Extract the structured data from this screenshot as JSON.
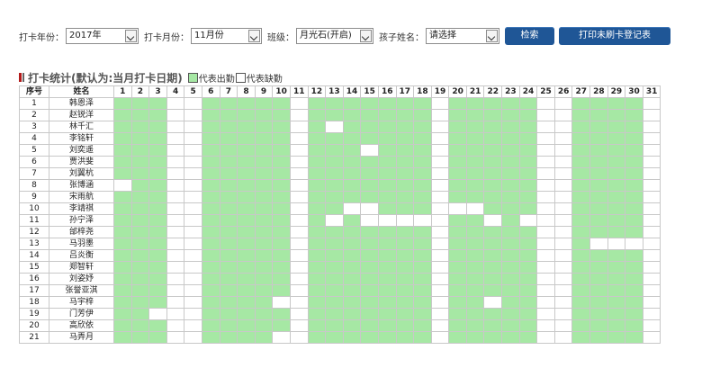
{
  "filters": {
    "year_label": "打卡年份：",
    "year_value": "2017年",
    "month_label": "打卡月份：",
    "month_value": "11月份",
    "class_label": "班级：",
    "class_value": "月光石(开启)",
    "child_label": "孩子姓名：",
    "child_value": "请选择",
    "search_button": "检索",
    "print_button": "打印未刷卡登记表"
  },
  "section": {
    "title": "打卡统计(默认为:当月打卡日期)",
    "legend_present": "代表出勤",
    "legend_absent": "代表缺勤",
    "present_color": "#a6e8a4",
    "absent_color": "#ffffff"
  },
  "table": {
    "col_no": "序号",
    "col_name": "姓名",
    "days": [
      "1",
      "2",
      "3",
      "4",
      "5",
      "6",
      "7",
      "8",
      "9",
      "10",
      "11",
      "12",
      "13",
      "14",
      "15",
      "16",
      "17",
      "18",
      "19",
      "20",
      "21",
      "22",
      "23",
      "24",
      "25",
      "26",
      "27",
      "28",
      "29",
      "30",
      "31"
    ],
    "rows": [
      {
        "no": "1",
        "name": "韩恩泽",
        "attendance": "1110011111011111110111110011110"
      },
      {
        "no": "2",
        "name": "赵锐洋",
        "attendance": "1110011111011111110111110011110"
      },
      {
        "no": "3",
        "name": "林千汇",
        "attendance": "1110011111010111110111110011110"
      },
      {
        "no": "4",
        "name": "李铭轩",
        "attendance": "1110011111011111110111110011110"
      },
      {
        "no": "5",
        "name": "刘奕遥",
        "attendance": "1110011111011101110111110011110"
      },
      {
        "no": "6",
        "name": "贾洪斐",
        "attendance": "1110011111011111110111110011110"
      },
      {
        "no": "7",
        "name": "刘翼杭",
        "attendance": "1110011111011111110111110011110"
      },
      {
        "no": "8",
        "name": "张博涵",
        "attendance": "0110011111011111110111110011110"
      },
      {
        "no": "9",
        "name": "宋雨航",
        "attendance": "1110011111011111110111110011110"
      },
      {
        "no": "10",
        "name": "李靖祺",
        "attendance": "1110011111011001110001110011110"
      },
      {
        "no": "11",
        "name": "孙宁泽",
        "attendance": "1110011111010100000110100011110"
      },
      {
        "no": "12",
        "name": "邰梓尧",
        "attendance": "1110011111011111110111110011110"
      },
      {
        "no": "13",
        "name": "马羽墨",
        "attendance": "1110011111011111110111110010000"
      },
      {
        "no": "14",
        "name": "吕炎衡",
        "attendance": "1110011111011111110111110011110"
      },
      {
        "no": "15",
        "name": "郑智轩",
        "attendance": "1110011111011111110111110011110"
      },
      {
        "no": "16",
        "name": "刘姿妤",
        "attendance": "1110011111011111110111110011110"
      },
      {
        "no": "17",
        "name": "张誉亚淇",
        "attendance": "1110011111011111110111110011110"
      },
      {
        "no": "18",
        "name": "马宇梓",
        "attendance": "1110011110011111110110110011110"
      },
      {
        "no": "19",
        "name": "门芳伊",
        "attendance": "1100011111011111110111110011110"
      },
      {
        "no": "20",
        "name": "高欣依",
        "attendance": "1110011111011111110111110011110"
      },
      {
        "no": "21",
        "name": "马弄月",
        "attendance": "1110011110011111110111110011110"
      }
    ]
  }
}
